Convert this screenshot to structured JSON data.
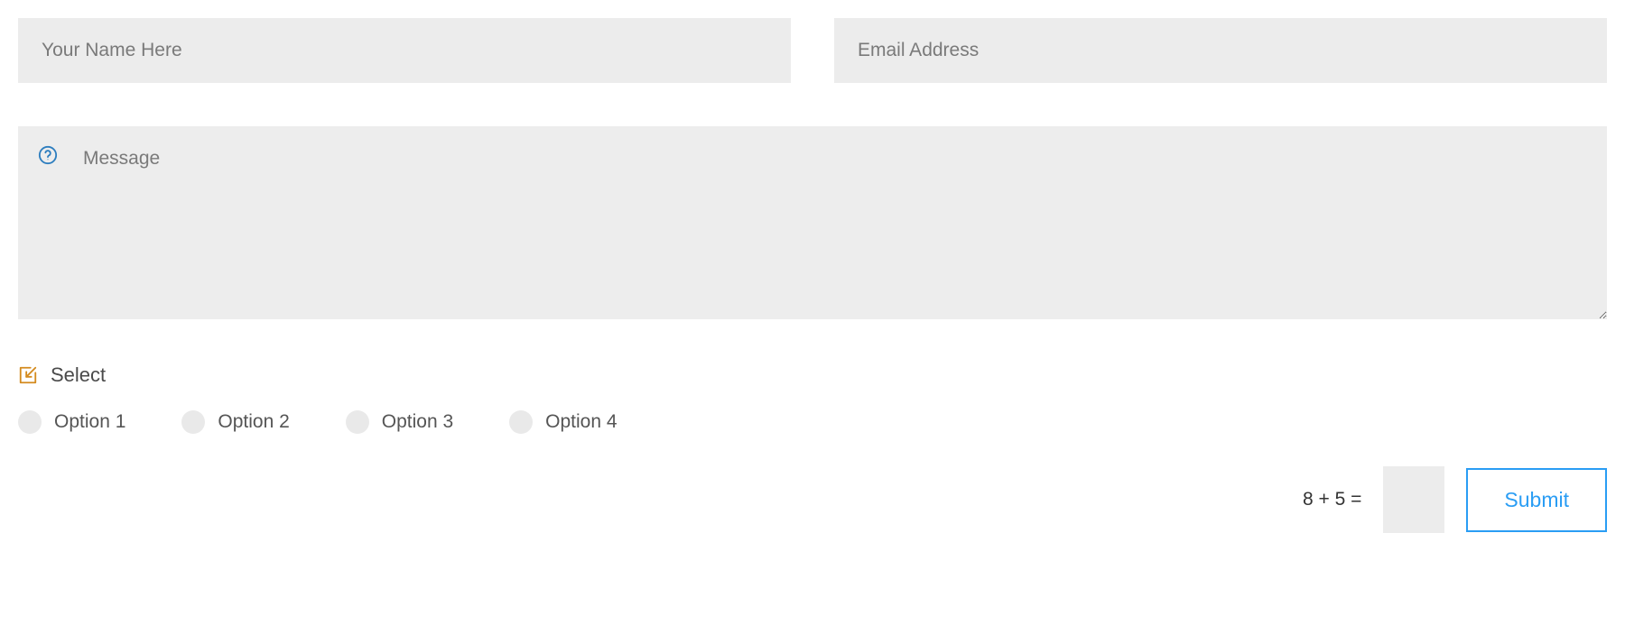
{
  "fields": {
    "name": {
      "placeholder": "Your Name Here",
      "value": ""
    },
    "email": {
      "placeholder": "Email Address",
      "value": ""
    },
    "message": {
      "placeholder": "Message",
      "value": ""
    }
  },
  "select": {
    "label": "Select",
    "options": [
      "Option 1",
      "Option 2",
      "Option 3",
      "Option 4"
    ]
  },
  "captcha": {
    "question": "8 + 5 =",
    "value": ""
  },
  "submit": {
    "label": "Submit"
  }
}
